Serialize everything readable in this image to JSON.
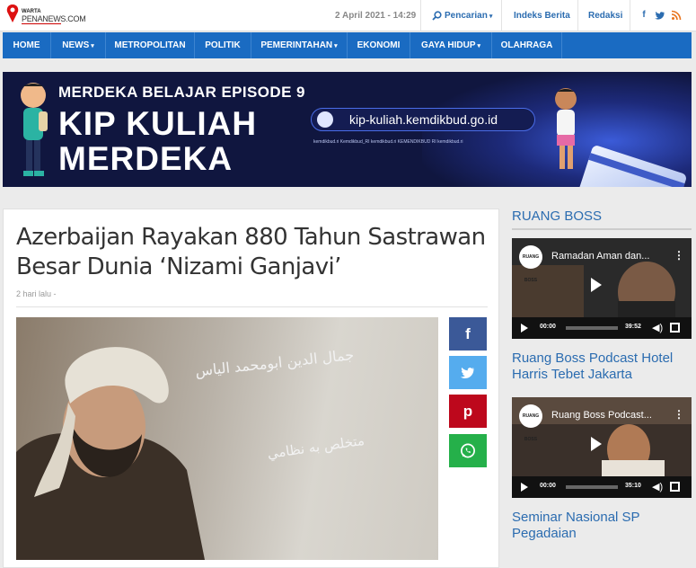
{
  "header": {
    "logo_top": "WARTA",
    "logo_bottom": "PENANEWS.COM",
    "date": "2 April 2021 - 14:29",
    "search_label": "Pencarian",
    "index_label": "Indeks Berita",
    "redaksi_label": "Redaksi",
    "social": [
      "f",
      "t",
      "rss"
    ]
  },
  "nav": {
    "items": [
      "HOME",
      "NEWS",
      "METROPOLITAN",
      "POLITIK",
      "PEMERINTAHAN",
      "EKONOMI",
      "GAYA HIDUP",
      "OLAHRAGA"
    ]
  },
  "banner": {
    "episode": "MERDEKA BELAJAR EPISODE 9",
    "title_line1": "KIP KULIAH",
    "title_line2": "MERDEKA",
    "url": "kip-kuliah.kemdikbud.go.id",
    "socials": "kemdikbud.ri   Kemdikbud_RI   kemdikbud.ri   KEMENDIKBUD RI   kemdikbud.ri"
  },
  "article": {
    "title": "Azerbaijan Rayakan 880 Tahun Sastrawan Besar Dunia ‘Nizami Ganjavi’",
    "meta": "2 hari lalu  -",
    "share_labels": [
      "f",
      "t",
      "p",
      "w"
    ]
  },
  "sidebar": {
    "heading": "RUANG BOSS",
    "videos": [
      {
        "title": "Ramadan Aman dan...",
        "elapsed": "00:00",
        "duration": "39:52",
        "badge": "RUANG BOSS"
      },
      {
        "title": "Ruang Boss Podcast...",
        "elapsed": "00:00",
        "duration": "35:10",
        "badge": "RUANG BOSS"
      }
    ],
    "post_titles": [
      "Ruang Boss Podcast Hotel Harris Tebet Jakarta",
      "Seminar Nasional SP Pegadaian"
    ]
  },
  "colors": {
    "nav": "#1a6bc2",
    "link": "#2b6cb0",
    "facebook": "#3b5998",
    "twitter": "#55acee",
    "pinterest": "#bd081c",
    "whatsapp": "#25b04a"
  }
}
